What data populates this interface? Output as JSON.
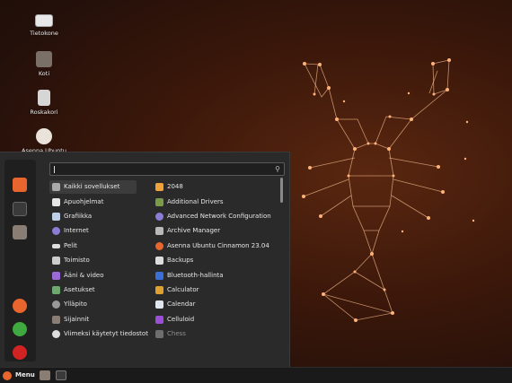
{
  "desktop": {
    "icons": [
      {
        "label": "Tietokone",
        "icon": "computer-icon"
      },
      {
        "label": "Koti",
        "icon": "home-folder-icon"
      },
      {
        "label": "Roskakori",
        "icon": "trash-icon"
      },
      {
        "label": "Asenna Ubuntu",
        "icon": "installer-icon"
      }
    ]
  },
  "menu": {
    "search": {
      "placeholder": "",
      "value": ""
    },
    "favorites": [
      "firefox-icon",
      "terminal-icon",
      "files-icon"
    ],
    "session": [
      "lock-icon",
      "logout-icon",
      "power-icon"
    ],
    "categories": [
      {
        "label": "Kaikki sovellukset",
        "icon": "grid-icon",
        "selected": true
      },
      {
        "label": "Apuohjelmat",
        "icon": "accessories-icon"
      },
      {
        "label": "Grafiikka",
        "icon": "graphics-icon"
      },
      {
        "label": "Internet",
        "icon": "internet-icon"
      },
      {
        "label": "Pelit",
        "icon": "games-icon"
      },
      {
        "label": "Toimisto",
        "icon": "office-icon"
      },
      {
        "label": "Ääni & video",
        "icon": "multimedia-icon"
      },
      {
        "label": "Asetukset",
        "icon": "settings-icon"
      },
      {
        "label": "Ylläpito",
        "icon": "administration-icon"
      },
      {
        "label": "Sijainnit",
        "icon": "places-icon"
      },
      {
        "label": "Viimeksi käytetyt tiedostot",
        "icon": "recent-files-icon"
      }
    ],
    "apps": [
      {
        "label": "2048",
        "icon": "game-2048-icon"
      },
      {
        "label": "Additional Drivers",
        "icon": "drivers-icon"
      },
      {
        "label": "Advanced Network Configuration",
        "icon": "network-icon"
      },
      {
        "label": "Archive Manager",
        "icon": "archive-icon"
      },
      {
        "label": "Asenna Ubuntu Cinnamon 23.04",
        "icon": "installer-icon"
      },
      {
        "label": "Backups",
        "icon": "backups-icon"
      },
      {
        "label": "Bluetooth-hallinta",
        "icon": "bluetooth-icon"
      },
      {
        "label": "Calculator",
        "icon": "calculator-icon"
      },
      {
        "label": "Calendar",
        "icon": "calendar-icon"
      },
      {
        "label": "Celluloid",
        "icon": "video-player-icon"
      },
      {
        "label": "Chess",
        "icon": "chess-icon"
      }
    ]
  },
  "panel": {
    "menu_label": "Menu",
    "launchers": [
      "files-icon",
      "terminal-icon"
    ]
  },
  "colors": {
    "accent": "#e8662e",
    "menu_bg": "#2a2a2a",
    "panel_bg": "#1a1a1a"
  }
}
